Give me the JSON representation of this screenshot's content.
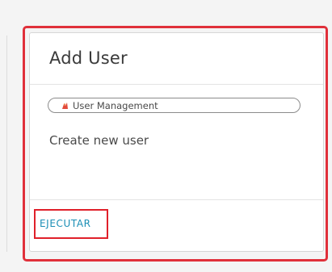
{
  "card": {
    "title": "Add User",
    "tag": {
      "label": "User Management",
      "icon": "user-management-icon"
    },
    "description": "Create new user",
    "action_label": "EJECUTAR"
  },
  "colors": {
    "action_link": "#1a8eb5",
    "highlight": "#e0303a",
    "tag_icon": "#e24a3b"
  }
}
